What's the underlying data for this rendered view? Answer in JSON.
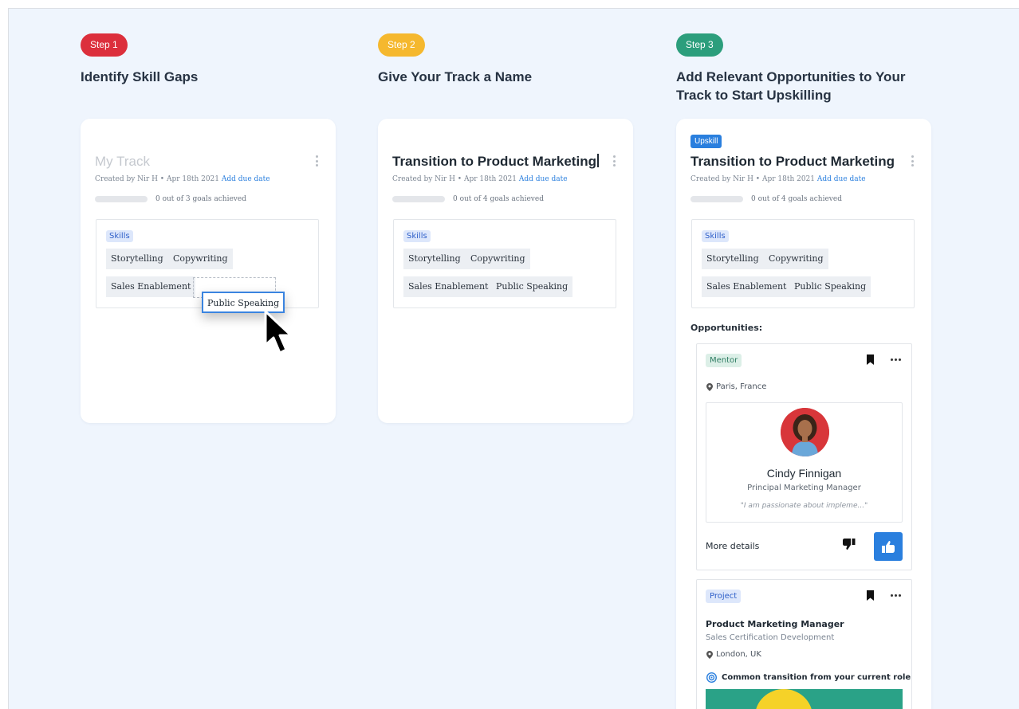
{
  "steps": [
    {
      "label": "Step 1",
      "title": "Identify Skill Gaps",
      "color": "#dc2f3c"
    },
    {
      "label": "Step 2",
      "title": "Give Your Track a Name",
      "color": "#f5b82e"
    },
    {
      "label": "Step 3",
      "title": "Add Relevant Opportunities to Your Track to Start Upskilling",
      "color": "#2c9e7c"
    }
  ],
  "card1": {
    "title": "My Track",
    "meta_prefix": "Created by Nir H • Apr 18th 2021",
    "due_link": "Add due date",
    "progress_text": "0 out of 3 goals achieved",
    "skills_label": "Skills",
    "skills": [
      "Storytelling",
      "Copywriting",
      "Sales Enablement"
    ],
    "dragging_skill": "Public Speaking"
  },
  "card2": {
    "title": "Transition to Product Marketing",
    "meta_prefix": "Created by Nir H • Apr 18th 2021",
    "due_link": "Add due date",
    "progress_text": "0 out of 4 goals achieved",
    "skills_label": "Skills",
    "skills": [
      "Storytelling",
      "Copywriting",
      "Sales Enablement",
      "Public Speaking"
    ]
  },
  "card3": {
    "badge": "Upskill",
    "title": "Transition to Product Marketing",
    "meta_prefix": "Created by Nir H • Apr 18th 2021",
    "due_link": "Add due date",
    "progress_text": "0 out of 4 goals achieved",
    "skills_label": "Skills",
    "skills": [
      "Storytelling",
      "Copywriting",
      "Sales Enablement",
      "Public Speaking"
    ],
    "opportunities_label": "Opportunities:",
    "mentor": {
      "tag": "Mentor",
      "location": "Paris, France",
      "name": "Cindy Finnigan",
      "role": "Principal Marketing Manager",
      "quote": "\"I am passionate about impleme...\"",
      "more_details": "More details"
    },
    "project": {
      "tag": "Project",
      "title": "Product Marketing Manager",
      "subtitle": "Sales Certification Development",
      "location": "London, UK",
      "transition_note": "Common transition from your current role"
    }
  },
  "colors": {
    "accent": "#2a7fde",
    "background": "#eff5fd",
    "mentor_tag_bg": "#dcefe7",
    "mentor_tag_fg": "#2f7d63",
    "project_tag_bg": "#dde7fb",
    "project_tag_fg": "#3060c9"
  },
  "icons": [
    "kebab-icon",
    "cursor-arrow-icon",
    "bookmark-icon",
    "more-icon",
    "location-pin-icon",
    "thumbs-down-icon",
    "thumbs-up-icon",
    "target-icon"
  ]
}
